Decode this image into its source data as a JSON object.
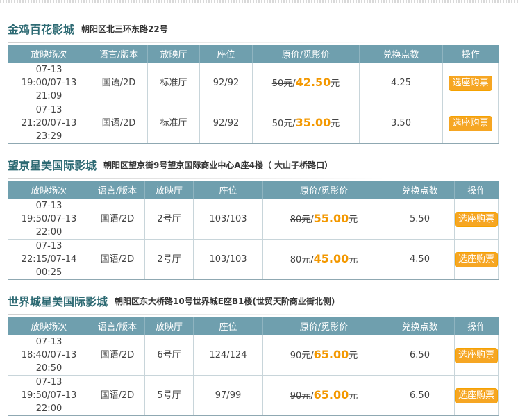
{
  "columns": [
    "放映场次",
    "语言/版本",
    "放映厅",
    "座位",
    "原价/觅影价",
    "兑换点数",
    "操作"
  ],
  "cinemas": [
    {
      "name": "金鸡百花影城",
      "address": "朝阳区北三环东路22号",
      "rows": [
        {
          "time1": "07-13",
          "time2": "19:00/07-13",
          "time3": "21:09",
          "lang": "国语/2D",
          "hall": "标准厅",
          "seats": "92/92",
          "old_price": "50元",
          "new_price": "42.50",
          "unit": "元",
          "points": "4.25",
          "action": "选座购票"
        },
        {
          "time1": "07-13",
          "time2": "21:20/07-13",
          "time3": "23:29",
          "lang": "国语/2D",
          "hall": "标准厅",
          "seats": "92/92",
          "old_price": "50元",
          "new_price": "35.00",
          "unit": "元",
          "points": "3.50",
          "action": "选座购票"
        }
      ]
    },
    {
      "name": "望京星美国际影城",
      "address": "朝阳区望京街9号望京国际商业中心A座4楼（ 大山子桥路口）",
      "rows": [
        {
          "time1": "07-13",
          "time2": "19:50/07-13",
          "time3": "22:00",
          "lang": "国语/2D",
          "hall": "2号厅",
          "seats": "103/103",
          "old_price": "80元",
          "new_price": "55.00",
          "unit": "元",
          "points": "5.50",
          "action": "选座购票"
        },
        {
          "time1": "07-13",
          "time2": "22:15/07-14",
          "time3": "00:25",
          "lang": "国语/2D",
          "hall": "2号厅",
          "seats": "103/103",
          "old_price": "80元",
          "new_price": "45.00",
          "unit": "元",
          "points": "4.50",
          "action": "选座购票"
        }
      ]
    },
    {
      "name": "世界城星美国际影城",
      "address": "朝阳区东大桥路10号世界城E座B1楼(世贸天阶商业街北侧)",
      "rows": [
        {
          "time1": "07-13",
          "time2": "18:40/07-13",
          "time3": "20:50",
          "lang": "国语/2D",
          "hall": "6号厅",
          "seats": "124/124",
          "old_price": "90元",
          "new_price": "65.00",
          "unit": "元",
          "points": "6.50",
          "action": "选座购票"
        },
        {
          "time1": "07-13",
          "time2": "19:50/07-13",
          "time3": "22:00",
          "lang": "国语/2D",
          "hall": "5号厅",
          "seats": "97/99",
          "old_price": "90元",
          "new_price": "65.00",
          "unit": "元",
          "points": "6.50",
          "action": "选座购票"
        }
      ]
    }
  ]
}
